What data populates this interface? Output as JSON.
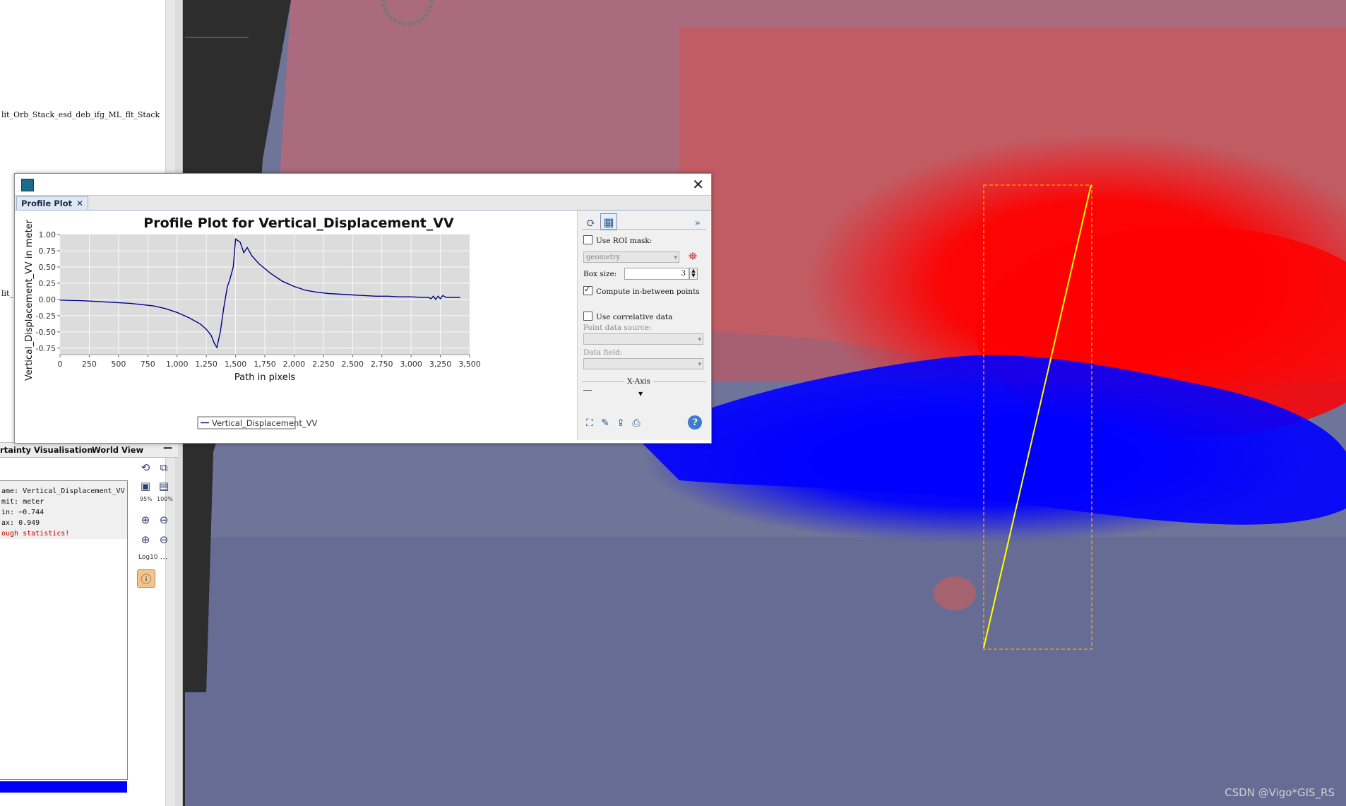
{
  "left_panel": {
    "tree_line_1": "lit_Orb_Stack_esd_deb_ifg_ML_flt_Stack",
    "tree_line_2": "lit_",
    "tabs": {
      "uncertainty": "rtainty Visualisation",
      "world_view": "World View",
      "minimize": "—"
    },
    "info": {
      "name": "ame: Vertical_Displacement_VV",
      "unit": "mit: meter",
      "min": "in: −0.744",
      "max": "ax: 0.949",
      "warning": "ough statistics!"
    },
    "tools": {
      "pct95": "95%",
      "pct100": "100%",
      "log": "Log10"
    },
    "colors": {
      "warning": "#cc0000",
      "bar": "#0000ff"
    }
  },
  "dialog": {
    "tab_label": "Profile Plot",
    "tab_close": "✕",
    "close": "✕"
  },
  "chart_data": {
    "type": "line",
    "title": "Profile Plot for Vertical_Displacement_VV",
    "xlabel": "Path in pixels",
    "ylabel": "Vertical_Displacement_VV in meter",
    "xlim": [
      0,
      3500
    ],
    "ylim": [
      -0.85,
      1.0
    ],
    "x_ticks": [
      "0",
      "250",
      "500",
      "750",
      "1,000",
      "1,250",
      "1,500",
      "1,750",
      "2,000",
      "2,250",
      "2,500",
      "2,750",
      "3,000",
      "3,250",
      "3,500"
    ],
    "x_tick_values": [
      0,
      250,
      500,
      750,
      1000,
      1250,
      1500,
      1750,
      2000,
      2250,
      2500,
      2750,
      3000,
      3250,
      3500
    ],
    "y_ticks": [
      "1.00",
      "0.75",
      "0.50",
      "0.25",
      "0.00",
      "-0.25",
      "-0.50",
      "-0.75"
    ],
    "y_tick_values": [
      1.0,
      0.75,
      0.5,
      0.25,
      0.0,
      -0.25,
      -0.5,
      -0.75
    ],
    "grid": true,
    "legend": "bottom-center",
    "series": [
      {
        "name": "Vertical_Displacement_VV",
        "color": "#00008b",
        "x": [
          0,
          200,
          400,
          600,
          800,
          900,
          1000,
          1100,
          1200,
          1250,
          1290,
          1320,
          1340,
          1370,
          1400,
          1430,
          1450,
          1480,
          1500,
          1540,
          1570,
          1600,
          1640,
          1700,
          1800,
          1900,
          2000,
          2100,
          2200,
          2300,
          2400,
          2500,
          2600,
          2700,
          2800,
          2900,
          3000,
          3100,
          3150,
          3170,
          3190,
          3210,
          3230,
          3250,
          3270,
          3300,
          3340,
          3420
        ],
        "y": [
          -0.01,
          -0.02,
          -0.04,
          -0.06,
          -0.1,
          -0.14,
          -0.2,
          -0.28,
          -0.38,
          -0.46,
          -0.55,
          -0.68,
          -0.74,
          -0.5,
          -0.12,
          0.2,
          0.3,
          0.5,
          0.93,
          0.88,
          0.72,
          0.8,
          0.67,
          0.55,
          0.4,
          0.28,
          0.2,
          0.14,
          0.11,
          0.09,
          0.08,
          0.07,
          0.06,
          0.05,
          0.05,
          0.04,
          0.04,
          0.03,
          0.03,
          0.01,
          0.05,
          0.0,
          0.05,
          0.01,
          0.06,
          0.03,
          0.03,
          0.03
        ]
      }
    ]
  },
  "side_panel": {
    "use_roi_mask": "Use ROI mask:",
    "roi_combo": "geometry",
    "box_size_label": "Box size:",
    "box_size_value": "3",
    "compute_between": "Compute in-between points",
    "use_correlative": "Use correlative data",
    "point_source": "Point data source:",
    "data_field": "Data field:",
    "x_axis": "X-Axis",
    "expand": "»"
  },
  "viewer": {
    "watermark": "CSDN @Vigo*GIS_RS",
    "colors": {
      "uplift": "#ff0000",
      "subsidence": "#0000ff",
      "neutral": "#7b7fa3",
      "line": "#ffff00",
      "box": "#ffa500"
    }
  }
}
